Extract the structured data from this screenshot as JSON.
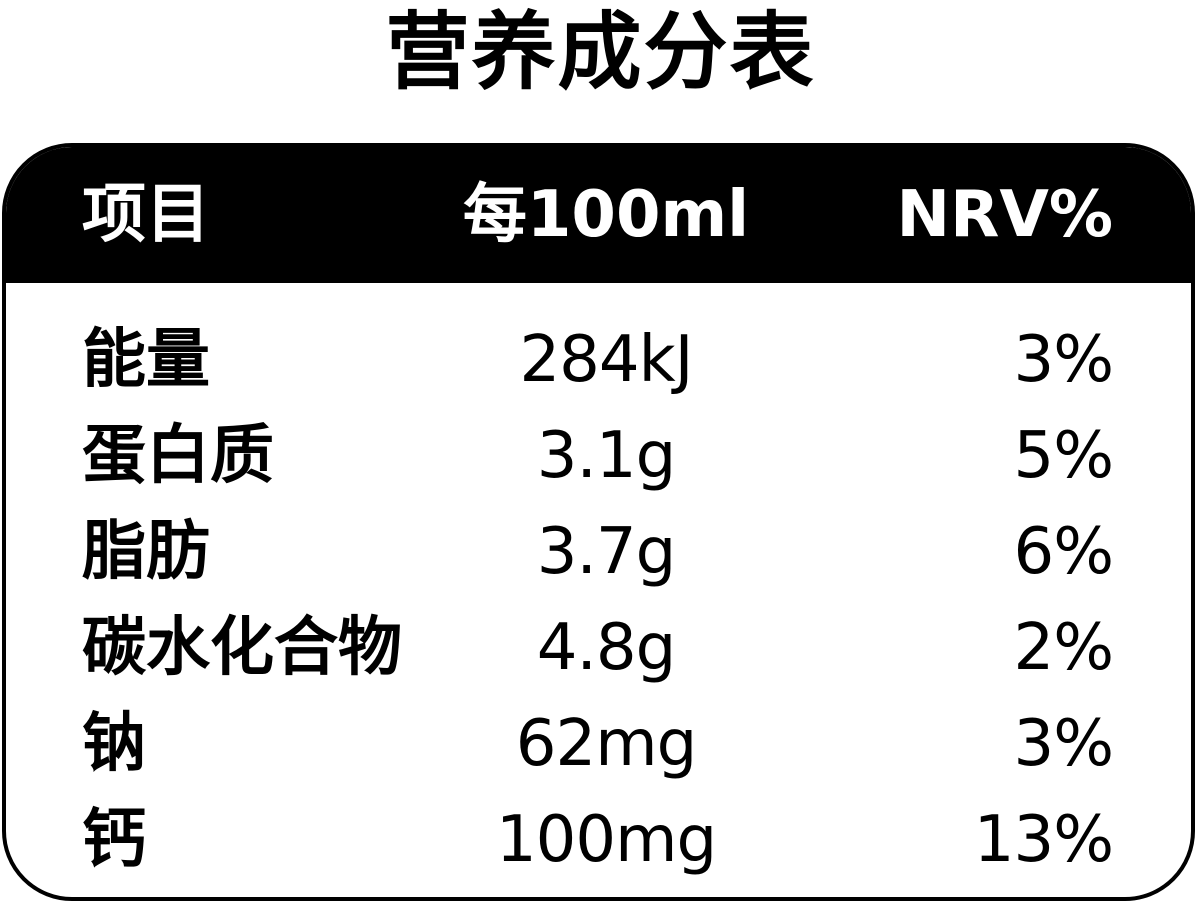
{
  "title": "营养成分表",
  "table": {
    "headers": {
      "item": "项目",
      "amount": "每100ml",
      "nrv": "NRV%"
    },
    "rows": [
      {
        "item": "能量",
        "amount": "284kJ",
        "nrv": "3%"
      },
      {
        "item": "蛋白质",
        "amount": "3.1g",
        "nrv": "5%"
      },
      {
        "item": "脂肪",
        "amount": "3.7g",
        "nrv": "6%"
      },
      {
        "item": "碳水化合物",
        "amount": "4.8g",
        "nrv": "2%"
      },
      {
        "item": "钠",
        "amount": "62mg",
        "nrv": "3%"
      },
      {
        "item": "钙",
        "amount": "100mg",
        "nrv": "13%"
      }
    ]
  },
  "colors": {
    "header_background": "#000000",
    "header_text": "#ffffff",
    "body_background": "#ffffff",
    "body_text": "#000000"
  }
}
